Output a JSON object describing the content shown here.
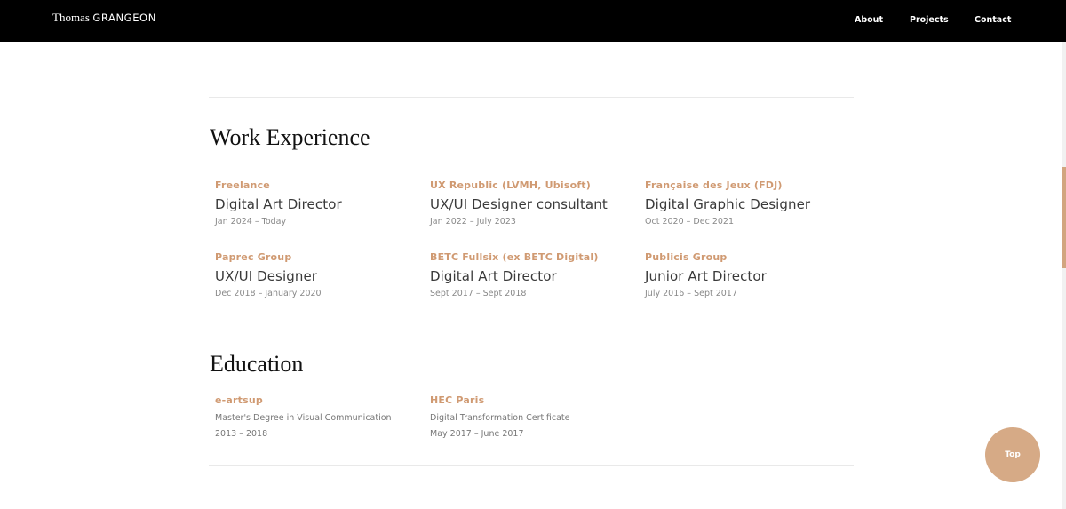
{
  "header": {
    "brand_first": "Thomas",
    "brand_last": "GRANGEON",
    "nav": [
      "About",
      "Projects",
      "Contact"
    ]
  },
  "work": {
    "title": "Work Experience",
    "items": [
      {
        "org": "Freelance",
        "role": "Digital Art Director",
        "dates": "Jan 2024 – Today"
      },
      {
        "org": "UX Republic (LVMH, Ubisoft)",
        "role": "UX/UI Designer consultant",
        "dates": "Jan 2022 – July 2023"
      },
      {
        "org": "Française des Jeux (FDJ)",
        "role": "Digital Graphic Designer",
        "dates": "Oct 2020 – Dec 2021"
      },
      {
        "org": "Paprec Group",
        "role": "UX/UI Designer",
        "dates": "Dec 2018 – January 2020"
      },
      {
        "org": "BETC Fullsix (ex BETC Digital)",
        "role": "Digital Art Director",
        "dates": "Sept 2017 – Sept 2018"
      },
      {
        "org": "Publicis Group",
        "role": "Junior Art Director",
        "dates": "July 2016 – Sept 2017"
      }
    ]
  },
  "education": {
    "title": "Education",
    "items": [
      {
        "org": "e-artsup",
        "degree": "Master's Degree in Visual Communication",
        "dates": "2013 – 2018"
      },
      {
        "org": "HEC Paris",
        "degree": "Digital Transformation Certificate",
        "dates": "May 2017 – June 2017"
      }
    ]
  },
  "top_button": "Top",
  "colors": {
    "header_bg": "#000000",
    "accent": "#d09a72",
    "top_button_bg": "#d6aa86"
  }
}
